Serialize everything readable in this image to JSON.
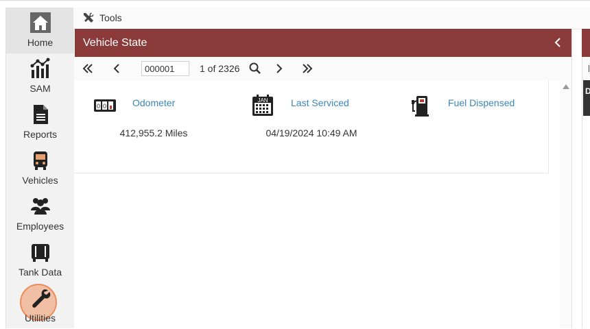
{
  "sidebar": {
    "items": [
      {
        "label": "Home",
        "icon": "home-icon",
        "active": true
      },
      {
        "label": "SAM",
        "icon": "sam-icon",
        "active": false
      },
      {
        "label": "Reports",
        "icon": "reports-icon",
        "active": false
      },
      {
        "label": "Vehicles",
        "icon": "bus-icon",
        "active": false
      },
      {
        "label": "Employees",
        "icon": "employees-icon",
        "active": false
      },
      {
        "label": "Tank Data",
        "icon": "tank-icon",
        "active": false
      },
      {
        "label": "Utilities",
        "icon": "wrench-icon",
        "active": false
      }
    ]
  },
  "toolbar": {
    "tools_label": "Tools",
    "tools_icon": "tools-icon"
  },
  "panel": {
    "title": "Vehicle State",
    "header_color": "#8b3a3a",
    "pager": {
      "record_value": "000001",
      "record_count": "1 of 2326"
    },
    "cards": [
      {
        "title": "Odometer",
        "value": "412,955.2 Miles",
        "icon": "odometer-icon"
      },
      {
        "title": "Last Serviced",
        "value": "04/19/2024 10:49 AM",
        "icon": "calendar-icon"
      },
      {
        "title": "Fuel Dispensed",
        "value": "",
        "icon": "fuel-pump-icon"
      }
    ]
  },
  "right_panel": {
    "peek_letter": "D"
  },
  "colors": {
    "accent": "#8b3a3a",
    "link": "#3a86b8",
    "click_marker": "#f0a070"
  }
}
